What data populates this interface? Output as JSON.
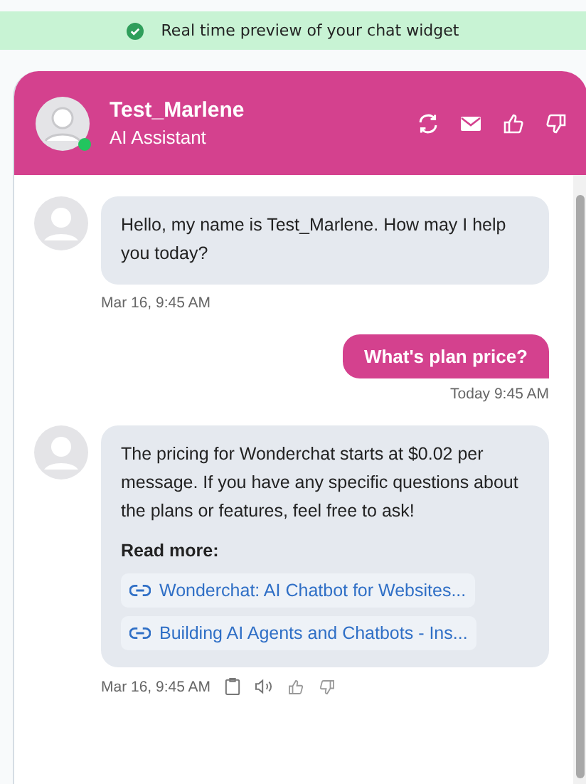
{
  "banner": {
    "text": "Real time preview of your chat widget"
  },
  "header": {
    "name": "Test_Marlene",
    "subtitle": "AI Assistant",
    "online": true
  },
  "messages": [
    {
      "kind": "bot",
      "text": "Hello, my name is Test_Marlene. How may I help you today?",
      "time": "Mar 16, 9:45 AM"
    },
    {
      "kind": "user",
      "text": "What's plan price?",
      "time": "Today 9:45 AM"
    },
    {
      "kind": "bot",
      "text": "The pricing for Wonderchat starts at $0.02 per message. If you have any specific questions about the plans or features, feel free to ask!",
      "read_more": "Read more:",
      "links": [
        "Wonderchat: AI Chatbot for Websites...",
        "Building AI Agents and Chatbots - Ins..."
      ],
      "time": "Mar 16, 9:45 AM",
      "actions": true
    }
  ]
}
